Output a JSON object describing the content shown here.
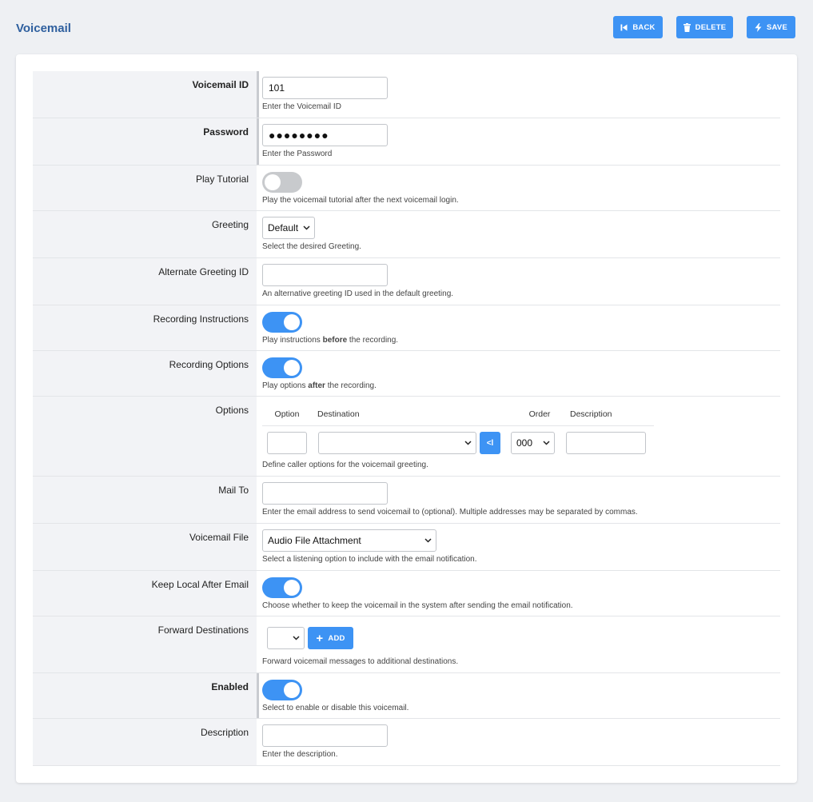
{
  "header": {
    "title": "Voicemail",
    "back_label": "BACK",
    "delete_label": "DELETE",
    "save_label": "SAVE"
  },
  "colors": {
    "accent": "#3d93f4",
    "title": "#2e5f9e"
  },
  "fields": {
    "voicemail_id": {
      "label": "Voicemail ID",
      "value": "101",
      "hint": "Enter the Voicemail ID"
    },
    "password": {
      "label": "Password",
      "value": "●●●●●●●●",
      "hint": "Enter the Password"
    },
    "play_tutorial": {
      "label": "Play Tutorial",
      "state": "off",
      "hint": "Play the voicemail tutorial after the next voicemail login."
    },
    "greeting": {
      "label": "Greeting",
      "value": "Default",
      "hint": "Select the desired Greeting."
    },
    "alt_greeting": {
      "label": "Alternate Greeting ID",
      "value": "",
      "hint": "An alternative greeting ID used in the default greeting."
    },
    "rec_instructions": {
      "label": "Recording Instructions",
      "state": "on",
      "hint_pre": "Play instructions ",
      "hint_bold": "before",
      "hint_post": " the recording."
    },
    "rec_options": {
      "label": "Recording Options",
      "state": "on",
      "hint_pre": "Play options ",
      "hint_bold": "after",
      "hint_post": " the recording."
    },
    "options": {
      "label": "Options",
      "col_option": "Option",
      "col_destination": "Destination",
      "col_order": "Order",
      "col_description": "Description",
      "option_value": "",
      "destination_value": "",
      "insert_label": "<l",
      "order_value": "000",
      "description_value": "",
      "hint": "Define caller options for the voicemail greeting."
    },
    "mail_to": {
      "label": "Mail To",
      "value": "",
      "hint": "Enter the email address to send voicemail to (optional). Multiple addresses may be separated by commas."
    },
    "voicemail_file": {
      "label": "Voicemail File",
      "value": "Audio File Attachment",
      "hint": "Select a listening option to include with the email notification."
    },
    "keep_local": {
      "label": "Keep Local After Email",
      "state": "on",
      "hint": "Choose whether to keep the voicemail in the system after sending the email notification."
    },
    "forward": {
      "label": "Forward Destinations",
      "value": "",
      "add_label": "ADD",
      "hint": "Forward voicemail messages to additional destinations."
    },
    "enabled": {
      "label": "Enabled",
      "state": "on",
      "hint": "Select to enable or disable this voicemail."
    },
    "description": {
      "label": "Description",
      "value": "",
      "hint": "Enter the description."
    }
  }
}
